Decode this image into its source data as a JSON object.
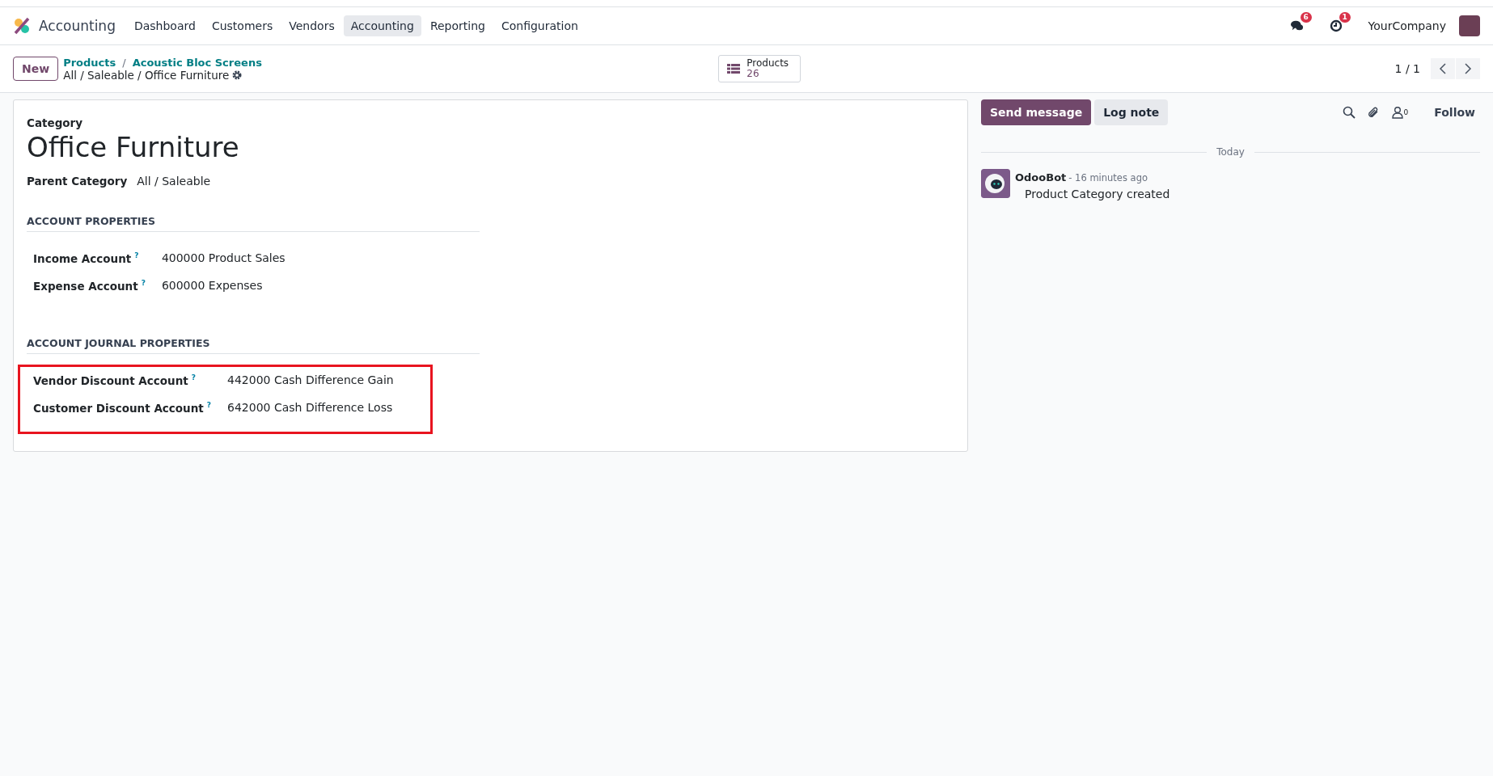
{
  "navbar": {
    "app_name": "Accounting",
    "menu": [
      {
        "label": "Dashboard",
        "selected": false
      },
      {
        "label": "Customers",
        "selected": false
      },
      {
        "label": "Vendors",
        "selected": false
      },
      {
        "label": "Accounting",
        "selected": true
      },
      {
        "label": "Reporting",
        "selected": false
      },
      {
        "label": "Configuration",
        "selected": false
      }
    ],
    "messages_badge": "6",
    "activities_badge": "1",
    "company": "YourCompany"
  },
  "control_panel": {
    "new_button": "New",
    "breadcrumbs": [
      "Products",
      "Acoustic Bloc Screens"
    ],
    "breadcrumb_separator": "/",
    "record_path": "All / Saleable / Office Furniture",
    "smart_button": {
      "label": "Products",
      "count": "26"
    },
    "pager": "1 / 1"
  },
  "form": {
    "category_label": "Category",
    "name": "Office Furniture",
    "parent_label": "Parent Category",
    "parent_value": "All / Saleable",
    "sections": [
      {
        "title": "ACCOUNT PROPERTIES",
        "highlighted": false,
        "fields": [
          {
            "label": "Income Account",
            "help": "?",
            "value": "400000 Product Sales"
          },
          {
            "label": "Expense Account",
            "help": "?",
            "value": "600000 Expenses"
          }
        ]
      },
      {
        "title": "ACCOUNT JOURNAL PROPERTIES",
        "highlighted": true,
        "fields": [
          {
            "label": "Vendor Discount Account",
            "help": "?",
            "value": "442000 Cash Difference Gain"
          },
          {
            "label": "Customer Discount Account",
            "help": "?",
            "value": "642000 Cash Difference Loss"
          }
        ]
      }
    ]
  },
  "chatter": {
    "send_message": "Send message",
    "log_note": "Log note",
    "followers_count": "0",
    "follow": "Follow",
    "date_separator": "Today",
    "messages": [
      {
        "author": "OdooBot",
        "time": "- 16 minutes ago",
        "body": "Product Category created"
      }
    ]
  }
}
